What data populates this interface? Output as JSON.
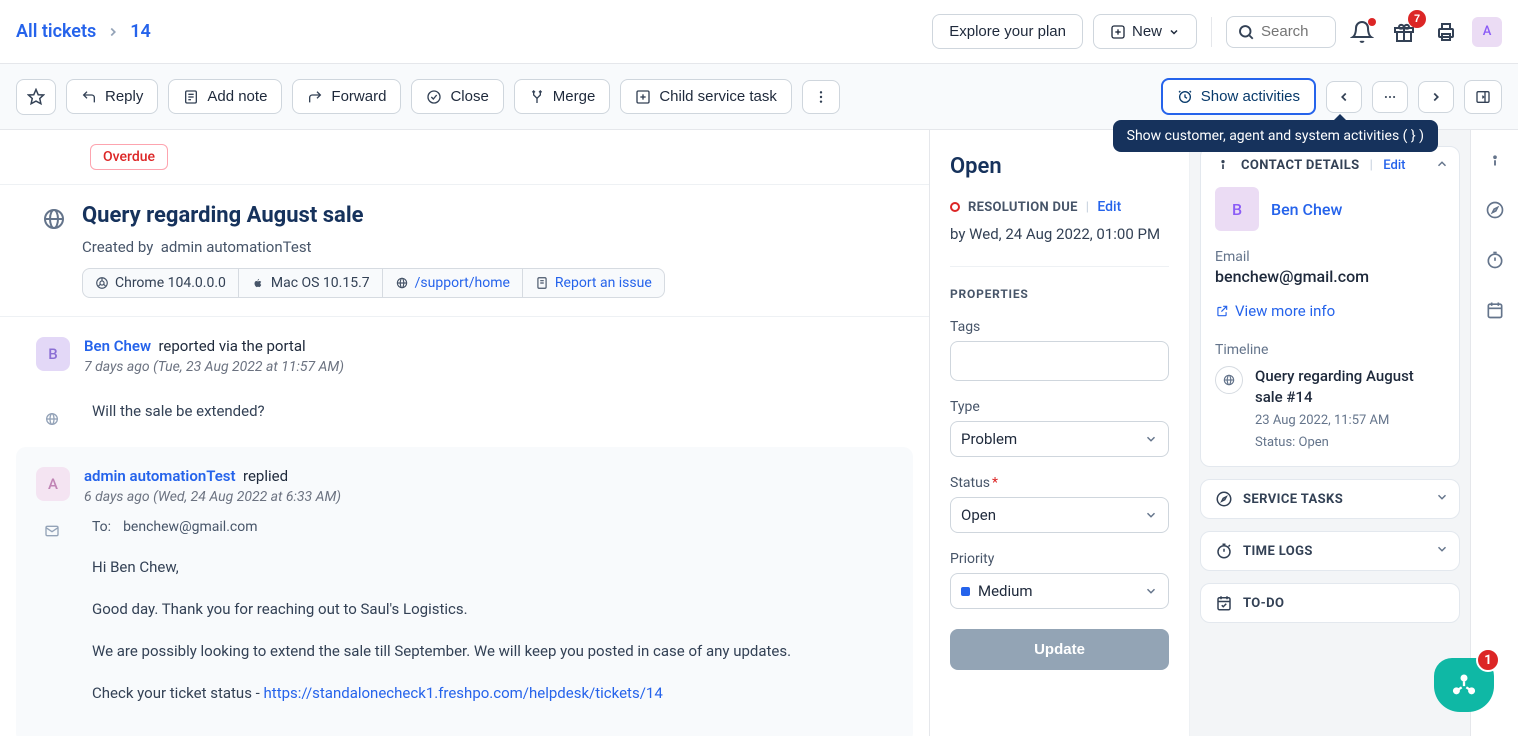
{
  "breadcrumb": {
    "root": "All tickets",
    "id": "14"
  },
  "topnav": {
    "explore": "Explore your plan",
    "new": "New",
    "search_placeholder": "Search",
    "gift_badge": "7",
    "avatar_letter": "A"
  },
  "toolbar": {
    "reply": "Reply",
    "add_note": "Add note",
    "forward": "Forward",
    "close": "Close",
    "merge": "Merge",
    "child_task": "Child service task",
    "show_activities": "Show activities",
    "tooltip": "Show customer, agent and system activities ( } )"
  },
  "overdue": "Overdue",
  "ticket": {
    "title": "Query regarding August sale",
    "created_label": "Created by",
    "creator": "admin automationTest",
    "chips": {
      "browser": "Chrome 104.0.0.0",
      "os": "Mac OS 10.15.7",
      "path": "/support/home",
      "report": "Report an issue"
    }
  },
  "entry1": {
    "avatar": "B",
    "who": "Ben Chew",
    "action": "reported via the portal",
    "sub": "7 days ago (Tue, 23 Aug 2022 at 11:57 AM)",
    "content": "Will the sale be extended?"
  },
  "entry2": {
    "avatar": "A",
    "who": "admin automationTest",
    "action": "replied",
    "sub": "6 days ago (Wed, 24 Aug 2022 at 6:33 AM)",
    "to_label": "To:",
    "to_value": "benchew@gmail.com",
    "p1": "Hi Ben Chew,",
    "p2": "Good day. Thank you for reaching out to Saul's Logistics.",
    "p3": "We are possibly looking to extend the sale till September.  We will keep you posted in case of any updates.",
    "p4_prefix": "Check your ticket status - ",
    "p4_link": "https://standalonecheck1.freshpo.com/helpdesk/tickets/14"
  },
  "props": {
    "status_title": "Open",
    "resolution_label": "RESOLUTION DUE",
    "edit": "Edit",
    "due_time": "by Wed, 24 Aug 2022, 01:00 PM",
    "section": "PROPERTIES",
    "tags_label": "Tags",
    "type_label": "Type",
    "type_value": "Problem",
    "status_label": "Status",
    "status_value": "Open",
    "priority_label": "Priority",
    "priority_value": "Medium",
    "update": "Update"
  },
  "contact": {
    "section": "CONTACT DETAILS",
    "edit": "Edit",
    "avatar": "B",
    "name": "Ben Chew",
    "email_label": "Email",
    "email_value": "benchew@gmail.com",
    "view_more": "View more info",
    "timeline_label": "Timeline",
    "timeline_title": "Query regarding August sale #14",
    "timeline_date": "23 Aug 2022, 11:57 AM",
    "timeline_status": "Status: Open"
  },
  "panels": {
    "service_tasks": "SERVICE TASKS",
    "time_logs": "TIME LOGS",
    "todo": "TO-DO"
  },
  "fab_badge": "1"
}
